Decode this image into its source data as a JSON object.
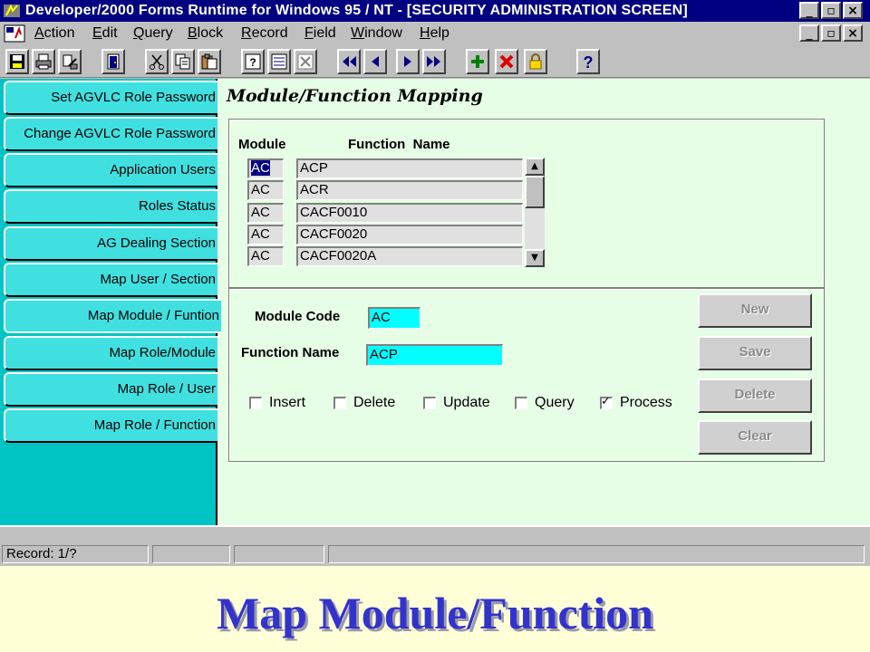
{
  "window": {
    "title": "Developer/2000 Forms Runtime for Windows 95 / NT - [SECURITY ADMINISTRATION SCREEN]",
    "controls": [
      "minimize-icon",
      "restore-icon",
      "close-icon"
    ]
  },
  "menu": {
    "items": [
      {
        "accel": "A",
        "rest": "ction"
      },
      {
        "accel": "E",
        "rest": "dit"
      },
      {
        "accel": "Q",
        "rest": "uery"
      },
      {
        "accel": "B",
        "rest": "lock"
      },
      {
        "accel": "R",
        "rest": "ecord"
      },
      {
        "accel": "F",
        "rest": "ield"
      },
      {
        "accel": "W",
        "rest": "indow"
      },
      {
        "accel": "H",
        "rest": "elp"
      }
    ]
  },
  "toolbar": {
    "icons": [
      "save-icon",
      "print-icon",
      "print-setup-icon",
      "exit-icon",
      "cut-icon",
      "copy-icon",
      "paste-icon",
      "enter-query-icon",
      "execute-query-icon",
      "cancel-query-icon",
      "first-record-icon",
      "previous-record-icon",
      "next-record-icon",
      "last-record-icon",
      "insert-record-icon",
      "delete-record-icon",
      "lock-record-icon",
      "help-icon"
    ]
  },
  "sidebar": {
    "tabs": [
      "Set AGVLC Role Password",
      "Change AGVLC Role Password",
      "Application Users",
      "Roles Status",
      "AG Dealing Section",
      "Map User / Section",
      "Map Module / Funtion",
      "Map Role/Module",
      "Map Role / User",
      "Map Role / Function"
    ],
    "active_index": 6
  },
  "main": {
    "heading": "Module/Function Mapping",
    "grid": {
      "headers": {
        "module": "Module",
        "function": "Function  Name"
      },
      "rows": [
        {
          "module": "AC",
          "function": "ACP"
        },
        {
          "module": "AC",
          "function": "ACR"
        },
        {
          "module": "AC",
          "function": "CACF0010"
        },
        {
          "module": "AC",
          "function": "CACF0020"
        },
        {
          "module": "AC",
          "function": "CACF0020A"
        }
      ]
    },
    "form": {
      "module_code_label": "Module Code",
      "module_code_value": "AC",
      "function_name_label": "Function Name",
      "function_name_value": "ACP"
    },
    "checkboxes": [
      {
        "label": "Insert",
        "checked": false
      },
      {
        "label": "Delete",
        "checked": false
      },
      {
        "label": "Update",
        "checked": false
      },
      {
        "label": "Query",
        "checked": false
      },
      {
        "label": "Process",
        "checked": true
      }
    ],
    "buttons": {
      "new": "New",
      "save": "Save",
      "delete": "Delete",
      "clear": "Clear"
    }
  },
  "status": {
    "record": "Record: 1/?"
  },
  "caption": "Map Module/Function"
}
